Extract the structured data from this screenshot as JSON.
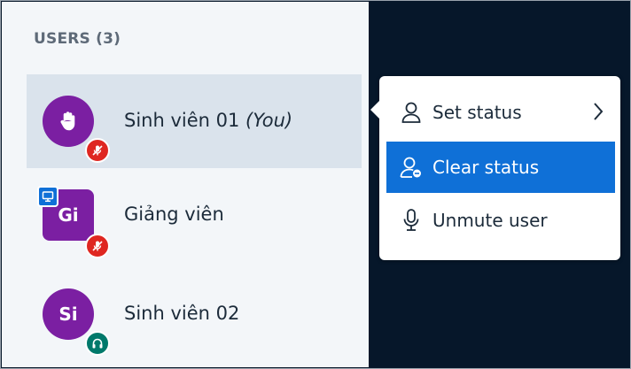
{
  "users_panel": {
    "title": "USERS (3)",
    "users": [
      {
        "avatar_text": "",
        "name": "Sinh viên 01",
        "tag": "(You)",
        "status": "raise-hand",
        "audio": "muted"
      },
      {
        "avatar_text": "Gi",
        "name": "Giảng viên",
        "tag": "",
        "role": "presenter",
        "audio": "muted"
      },
      {
        "avatar_text": "Si",
        "name": "Sinh viên 02",
        "tag": "",
        "audio": "listen-only"
      }
    ]
  },
  "context_menu": {
    "items": [
      {
        "label": "Set status",
        "icon": "user-icon",
        "has_submenu": true
      },
      {
        "label": "Clear status",
        "icon": "user-clear-icon",
        "highlighted": true
      },
      {
        "label": "Unmute user",
        "icon": "microphone-icon"
      }
    ]
  },
  "colors": {
    "avatar": "#7b1fa2",
    "muted_badge": "#df2721",
    "listen_badge": "#00796b",
    "highlight": "#0f70d7",
    "background": "#06172a"
  }
}
